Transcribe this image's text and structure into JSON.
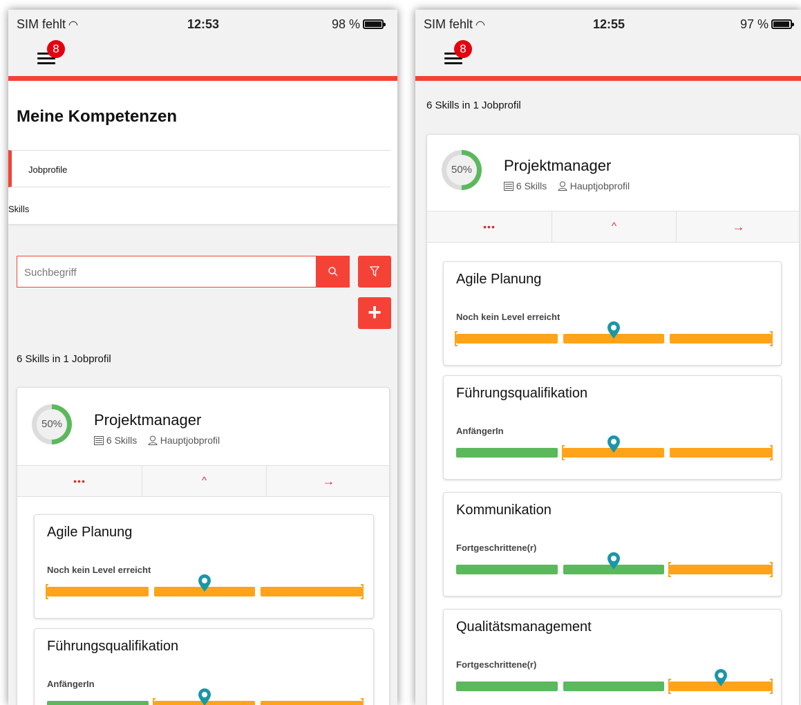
{
  "status_left": {
    "carrier": "SIM fehlt",
    "time": "12:53",
    "battery": "98 %",
    "battery_level": 0.98
  },
  "status_right": {
    "carrier": "SIM fehlt",
    "time": "12:55",
    "battery": "97 %",
    "battery_level": 0.97
  },
  "menu": {
    "badge": "8"
  },
  "page": {
    "title": "Meine Kompetenzen",
    "tabs": [
      {
        "label": "Jobprofile",
        "active": true
      },
      {
        "label": "Skills",
        "active": false
      }
    ]
  },
  "search": {
    "placeholder": "Suchbegriff"
  },
  "summary": "6 Skills in 1 Jobprofil",
  "job": {
    "progress_label": "50%",
    "progress_fraction": 0.5,
    "name": "Projektmanager",
    "skills_count": "6 Skills",
    "type": "Hauptjobprofil",
    "actions": [
      {
        "icon": "more-icon",
        "symbol": "•••"
      },
      {
        "icon": "chevron-up-icon",
        "symbol": "^"
      },
      {
        "icon": "arrow-right-icon",
        "symbol": "→"
      }
    ]
  },
  "skills": [
    {
      "name": "Agile Planung",
      "level": "Noch kein Level erreicht",
      "segments": [
        "orange",
        "orange",
        "orange"
      ],
      "target": 2
    },
    {
      "name": "Führungsqualifikation",
      "level": "AnfängerIn",
      "segments": [
        "green",
        "orange",
        "orange"
      ],
      "target": 2
    },
    {
      "name": "Kommunikation",
      "level": "Fortgeschrittene(r)",
      "segments": [
        "green",
        "green",
        "orange"
      ],
      "target": 2
    },
    {
      "name": "Qualitätsmanagement",
      "level": "Fortgeschrittene(r)",
      "segments": [
        "green",
        "green",
        "orange"
      ],
      "target": 3
    }
  ],
  "colors": {
    "accent": "#f44336",
    "badge": "#e4000f",
    "achieved": "#5cb85c",
    "pending": "#ffa31a",
    "marker": "#1b96a9"
  }
}
